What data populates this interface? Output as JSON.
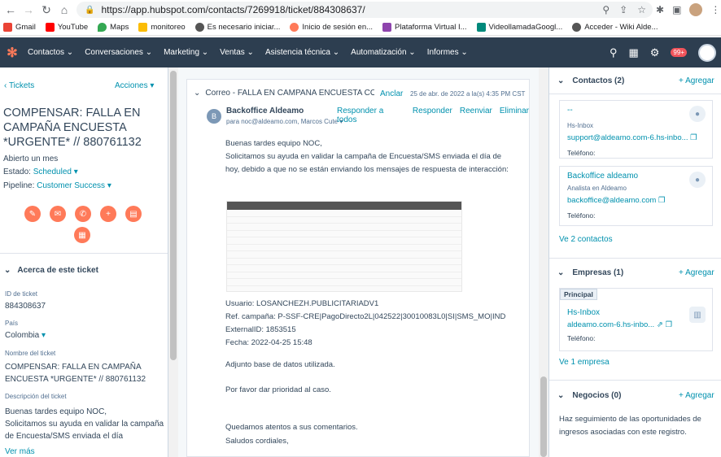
{
  "browser": {
    "url": "https://app.hubspot.com/contacts/7269918/ticket/884308637/",
    "bookmarks": [
      "Gmail",
      "YouTube",
      "Maps",
      "monitoreo",
      "Es necesario iniciar...",
      "Inicio de sesión en...",
      "Plataforma Virtual I...",
      "VideollamadaGoogl...",
      "Acceder - Wiki Alde..."
    ]
  },
  "nav": {
    "menu": [
      "Contactos",
      "Conversaciones",
      "Marketing",
      "Ventas",
      "Asistencia técnica",
      "Automatización",
      "Informes"
    ],
    "notif_badge": "99+"
  },
  "left": {
    "back_label": "Tickets",
    "actions_label": "Acciones",
    "title": "COMPENSAR: FALLA EN CAMPAÑA ENCUESTA *URGENTE* // 880761132",
    "opened": "Abierto un mes",
    "estado_label": "Estado:",
    "estado_value": "Scheduled",
    "pipeline_label": "Pipeline:",
    "pipeline_value": "Customer Success",
    "section_title": "Acerca de este ticket",
    "fields": [
      {
        "label": "ID de ticket",
        "value": "884308637"
      },
      {
        "label": "País",
        "value": "Colombia"
      },
      {
        "label": "Nombre del ticket",
        "value": "COMPENSAR: FALLA EN CAMPAÑA ENCUESTA *URGENTE* // 880761132"
      },
      {
        "label": "Descripción del ticket",
        "value": "Buenas tardes equipo NOC,\nSolicitamos su ayuda en validar la campaña de Encuesta/SMS enviada el día"
      }
    ],
    "ver_mas": "Ver más"
  },
  "email": {
    "subject": "Correo - FALLA EN CAMPAÑA ENCUESTA COM...",
    "anclar": "Anclar",
    "date": "25 de abr. de 2022 a la(s) 4:35 PM CST",
    "avatar_letter": "B",
    "sender": "Backoffice Aldeamo",
    "to": "para noc@aldeamo.com, Marcos Cute",
    "actions": [
      "Responder a todos",
      "Responder",
      "Reenviar",
      "Eliminar"
    ],
    "body1": "Buenas tardes equipo NOC,",
    "body2": "Solicitamos su ayuda en validar la campaña de Encuesta/SMS enviada el día de hoy, debido a que no se están enviando los mensajes de respuesta de interacción:",
    "usuario": "Usuario: LOSANCHEZH.PUBLICITARIADV1",
    "ref": "Ref. campaña: P-SSF-CRE|PagoDirecto2L|042522|30010083L0|SI|SMS_MO|IND",
    "external": "ExternalID: 1853515",
    "fecha": "Fecha:  2022-04-25 15:48",
    "adjunto": "Adjunto base de datos utilizada.",
    "prioridad": "Por favor dar prioridad al caso.",
    "quedamos": "Quedamos atentos a sus comentarios.",
    "saludos": "Saludos cordiales,"
  },
  "right": {
    "contacts_title": "Contactos (2)",
    "agregar": "+ Agregar",
    "contacts": [
      {
        "name": "--",
        "org": "Hs-Inbox",
        "email": "support@aldeamo.com-6.hs-inbo...",
        "phone_label": "Teléfono:"
      },
      {
        "name": "Backoffice aldeamo",
        "org": "Analista en Aldeamo",
        "email": "backoffice@aldeamo.com",
        "phone_label": "Teléfono:"
      }
    ],
    "ver_contactos": "Ve 2 contactos",
    "companies_title": "Empresas (1)",
    "company_badge": "Principal",
    "company_name": "Hs-Inbox",
    "company_domain": "aldeamo.com-6.hs-inbo...",
    "company_phone": "Teléfono:",
    "ver_empresa": "Ve 1 empresa",
    "deals_title": "Negocios (0)",
    "deals_text": "Haz seguimiento de las oportunidades de ingresos asociadas con este registro."
  }
}
